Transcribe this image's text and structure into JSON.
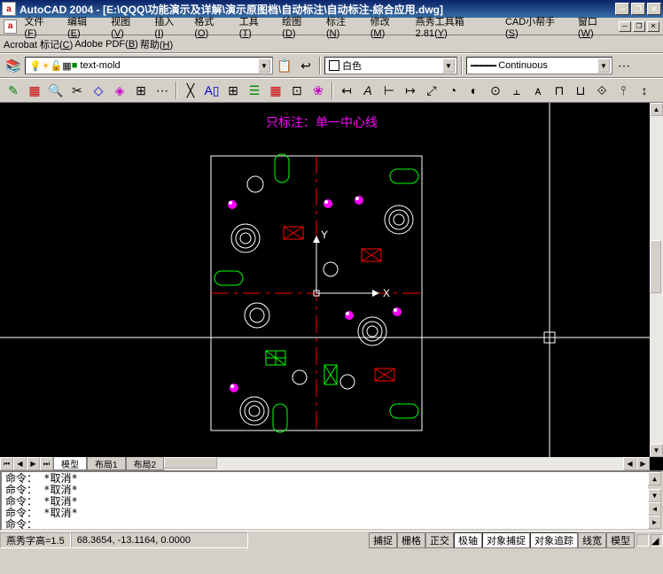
{
  "titlebar": {
    "app_icon": "a",
    "title": "AutoCAD 2004 - [E:\\QQQ\\功能演示及详解\\演示原图档\\自动标注\\自动标注-綜合应用.dwg]"
  },
  "menubar": {
    "items": [
      {
        "label": "文件",
        "key": "F"
      },
      {
        "label": "编辑",
        "key": "E"
      },
      {
        "label": "视图",
        "key": "V"
      },
      {
        "label": "插入",
        "key": "I"
      },
      {
        "label": "格式",
        "key": "O"
      },
      {
        "label": "工具",
        "key": "T"
      },
      {
        "label": "绘图",
        "key": "D"
      },
      {
        "label": "标注",
        "key": "N"
      },
      {
        "label": "修改",
        "key": "M"
      },
      {
        "label": "燕秀工具箱2.81",
        "key": "Y"
      },
      {
        "label": "CAD小帮手",
        "key": "S"
      },
      {
        "label": "窗口",
        "key": "W"
      }
    ]
  },
  "submenubar": {
    "items": [
      {
        "label": "Acrobat 标记",
        "key": "C"
      },
      {
        "label": "Adobe PDF",
        "key": "B"
      },
      {
        "label": "帮助",
        "key": "H"
      }
    ]
  },
  "toolbar1": {
    "layer_value": "text-mold",
    "layer_icons": "💡 ☀ 🔒 📄",
    "color_value": "白色",
    "linetype_value": "Continuous"
  },
  "canvas": {
    "title_annotation": "只标注：单一中心线",
    "axis_x": "X",
    "axis_y": "Y"
  },
  "tabs": {
    "model": "模型",
    "layout1": "布局1",
    "layout2": "布局2"
  },
  "command": {
    "lines": [
      "命令： *取消*",
      "命令： *取消*",
      "命令： *取消*",
      "命令： *取消*"
    ],
    "prompt": "命令："
  },
  "status": {
    "text_height": "燕秀字高=1.5",
    "coords": "68.3654, -13.1164, 0.0000",
    "toggles": [
      {
        "label": "捕捉",
        "on": false
      },
      {
        "label": "栅格",
        "on": false
      },
      {
        "label": "正交",
        "on": false
      },
      {
        "label": "极轴",
        "on": true
      },
      {
        "label": "对象捕捉",
        "on": true
      },
      {
        "label": "对象追踪",
        "on": true
      },
      {
        "label": "线宽",
        "on": false
      },
      {
        "label": "模型",
        "on": false
      }
    ]
  }
}
